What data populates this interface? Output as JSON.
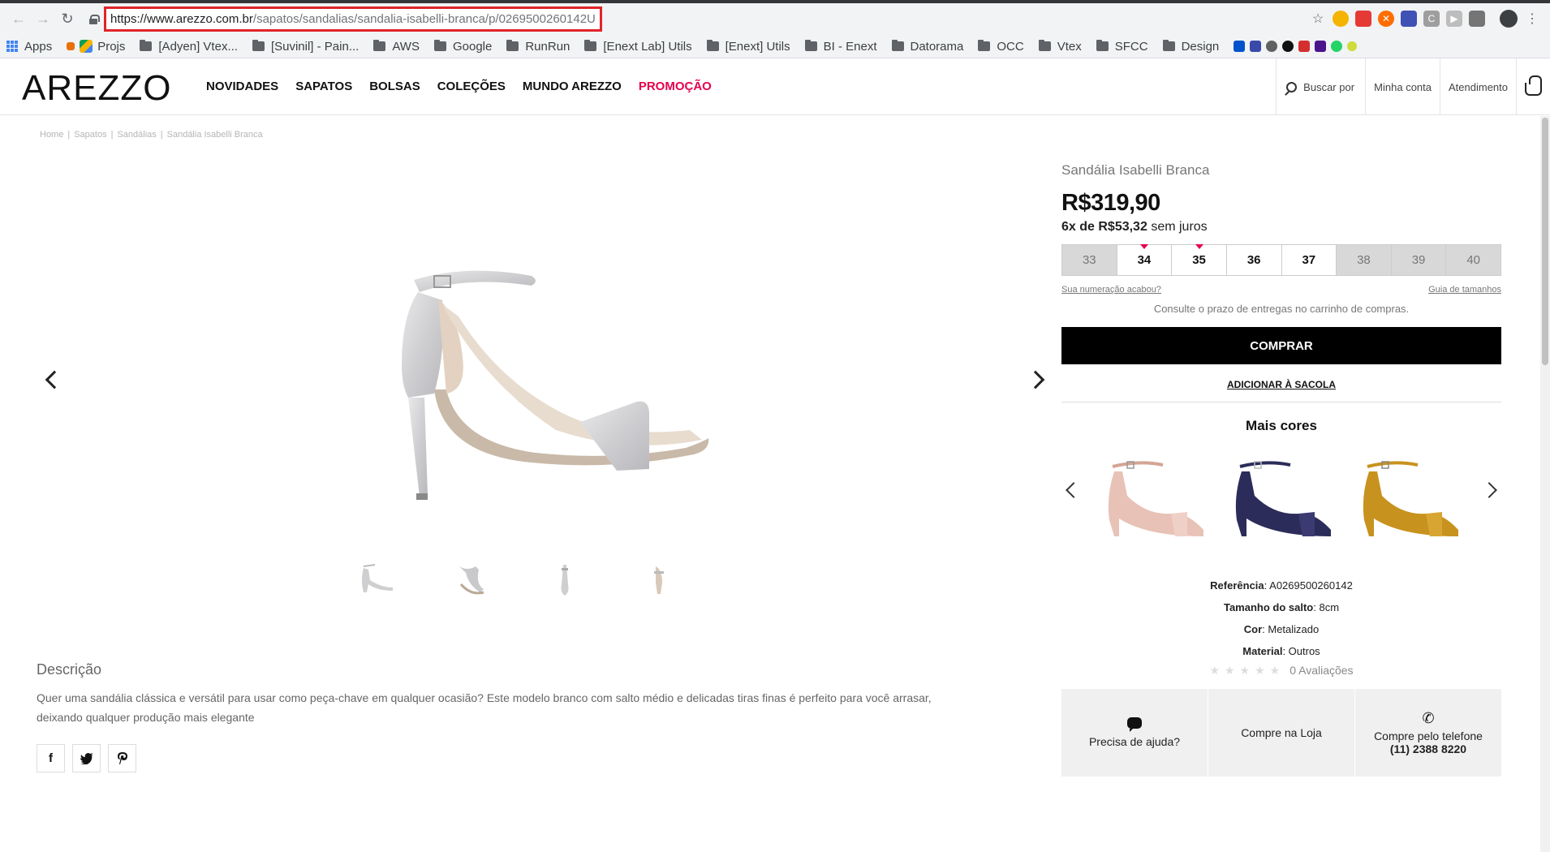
{
  "browser": {
    "url_domain": "https://www.arezzo.com.br",
    "url_path": "/sapatos/sandalias/sandalia-isabelli-branca/p/0269500260142U",
    "bookmarks": [
      "Apps",
      "Projs",
      "[Adyen] Vtex...",
      "[Suvinil] - Pain...",
      "AWS",
      "Google",
      "RunRun",
      "[Enext Lab] Utils",
      "[Enext] Utils",
      "BI - Enext",
      "Datorama",
      "OCC",
      "Vtex",
      "SFCC",
      "Design"
    ]
  },
  "header": {
    "logo": "AREZZO",
    "nav": [
      "NOVIDADES",
      "SAPATOS",
      "BOLSAS",
      "COLEÇÕES",
      "MUNDO AREZZO",
      "PROMOÇÃO"
    ],
    "search_label": "Buscar por",
    "account_label": "Minha conta",
    "support_label": "Atendimento"
  },
  "breadcrumb": [
    "Home",
    "Sapatos",
    "Sandálias",
    "Sandália Isabelli Branca"
  ],
  "product": {
    "name": "Sandália Isabelli Branca",
    "price": "R$319,90",
    "installments_prefix": "6x de R$53,32",
    "installments_suffix": "sem juros",
    "sizes": [
      {
        "label": "33",
        "available": false,
        "low_stock": false
      },
      {
        "label": "34",
        "available": true,
        "low_stock": true
      },
      {
        "label": "35",
        "available": true,
        "low_stock": true
      },
      {
        "label": "36",
        "available": true,
        "low_stock": false
      },
      {
        "label": "37",
        "available": true,
        "low_stock": false
      },
      {
        "label": "38",
        "available": false,
        "low_stock": false
      },
      {
        "label": "39",
        "available": false,
        "low_stock": false
      },
      {
        "label": "40",
        "available": false,
        "low_stock": false
      }
    ],
    "size_out_link": "Sua numeração acabou?",
    "size_guide_link": "Guia de tamanhos",
    "ship_note": "Consulte o prazo de entregas no carrinho de compras.",
    "buy_label": "COMPRAR",
    "add_bag_label": "ADICIONAR À SACOLA",
    "more_colors_title": "Mais cores",
    "color_variants": [
      "nude",
      "navy",
      "mustard"
    ],
    "specs": {
      "ref_label": "Referência",
      "ref_value": "A0269500260142",
      "heel_label": "Tamanho do salto",
      "heel_value": "8cm",
      "color_label": "Cor",
      "color_value": "Metalizado",
      "material_label": "Material",
      "material_value": "Outros"
    },
    "rating_text": "0 Avaliações",
    "description_title": "Descrição",
    "description": "Quer uma sandália clássica e versátil para usar como peça-chave em qualquer ocasião? Este modelo branco com salto médio e delicadas tiras finas é perfeito para você arrasar, deixando qualquer produção mais elegante"
  },
  "help": {
    "need_help": "Precisa de ajuda?",
    "buy_store": "Compre na Loja",
    "buy_phone": "Compre pelo telefone",
    "phone": "(11) 2388 8220"
  },
  "colors": {
    "accent": "#e5004d",
    "buy_bg": "#000000",
    "unavailable_size_bg": "#d8d8d8"
  }
}
